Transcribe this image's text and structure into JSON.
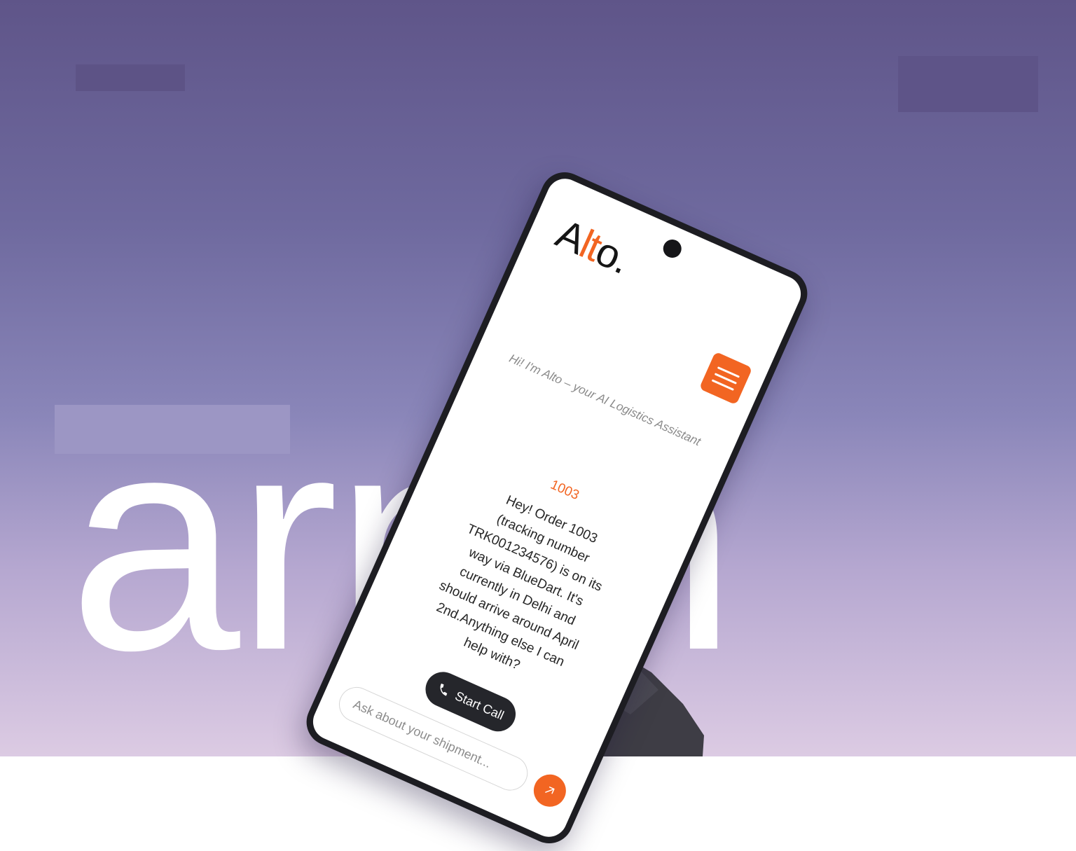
{
  "background": {
    "word": "arnin",
    "colors": {
      "top": "#5f5589",
      "bottom": "#dccbe3"
    }
  },
  "phone": {
    "logo": {
      "prefix": "A",
      "accent": "lt",
      "suffix": "o."
    },
    "accent_color": "#f26522",
    "menu_icon": "hamburger-icon",
    "greeting": "Hi! I'm Alto – your AI Logistics Assistant",
    "order_number": "1003",
    "reply": "Hey! Order 1003 (tracking number TRK001234576) is on its way via BlueDart. It's currently in Delhi and should arrive around April 2nd.Anything else I can help with?",
    "call_button": {
      "label": "Start Call",
      "icon": "phone-icon"
    },
    "input": {
      "value": "",
      "placeholder": "Ask about your shipment..."
    },
    "send_icon": "arrow-up-right-icon"
  }
}
